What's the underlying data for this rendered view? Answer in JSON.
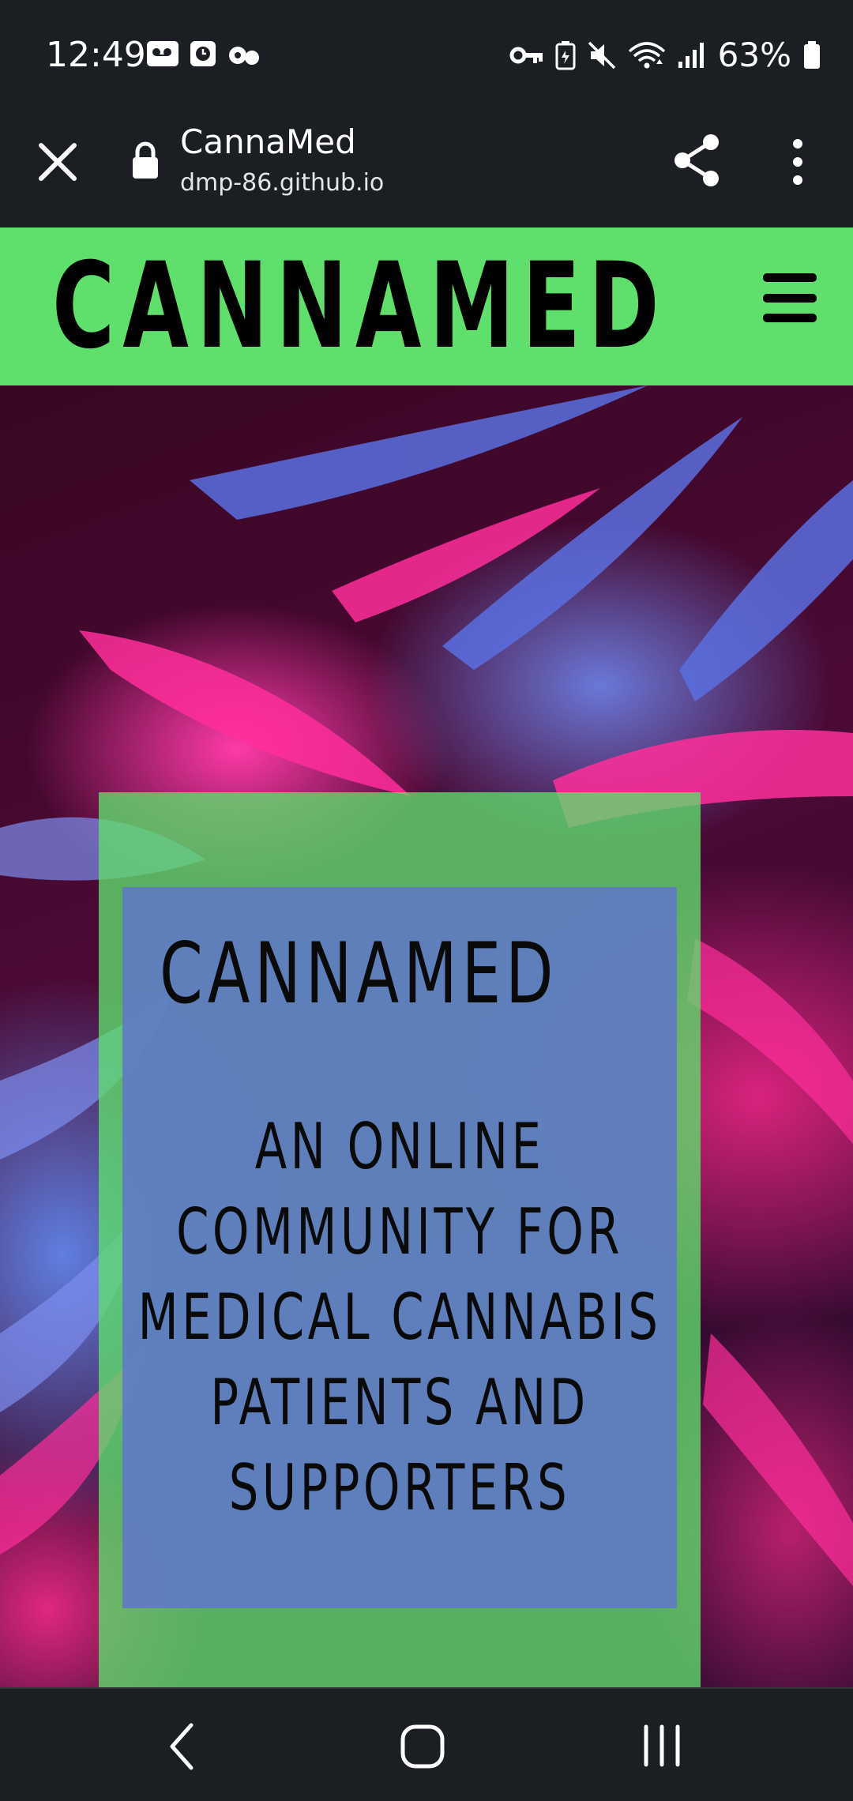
{
  "status_bar": {
    "time": "12:49",
    "battery": "63%",
    "left_icons": [
      "voicemail-icon",
      "clock-app-icon",
      "assistant-icon"
    ],
    "right_icons": [
      "vpn-key-icon",
      "battery-saver-icon",
      "mute-icon",
      "wifi-icon",
      "signal-icon",
      "battery-icon"
    ]
  },
  "browser": {
    "title": "CannaMed",
    "url": "dmp-86.github.io",
    "icons": [
      "close-icon",
      "lock-icon",
      "share-icon",
      "more-vert-icon"
    ]
  },
  "site": {
    "logo": "CANNAMED",
    "nav_bg": "#5fdf6c",
    "menu_icon": "hamburger-menu-icon"
  },
  "hero": {
    "heading": "CANNAMED",
    "subheading": "AN ONLINE COMMUNITY FOR MEDICAL CANNABIS PATIENTS AND SUPPORTERS",
    "panel_green": "#5fdf6c",
    "panel_blue": "#6078c8"
  },
  "nav_bar": {
    "icons": [
      "back-icon",
      "home-icon",
      "recents-icon"
    ]
  }
}
